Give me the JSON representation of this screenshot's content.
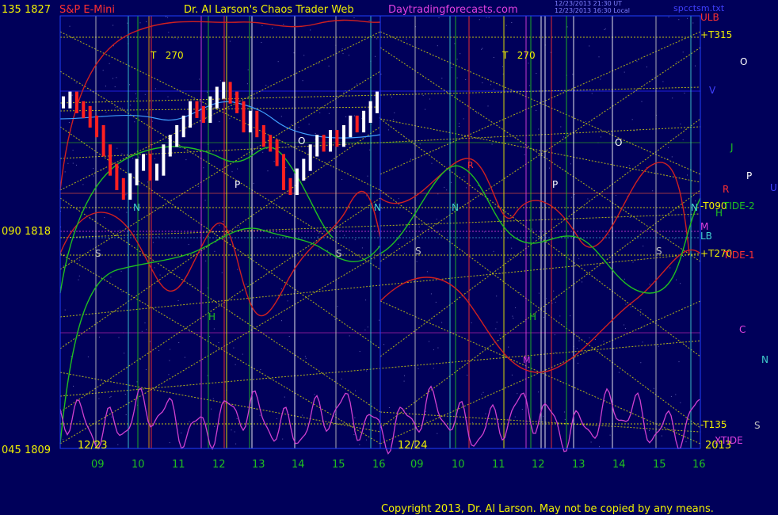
{
  "header": {
    "y_top_label": "135  1827",
    "instrument": "S&P E-Mini",
    "site_title": "Dr. Al Larson's Chaos Trader Web",
    "site_url": "Daytradingforecasts.com",
    "timestamp_1": "12/23/2013 21:30 UT",
    "timestamp_2": "12/23/2013 16:30 Local",
    "filename": "spcctsm.txt"
  },
  "y_labels": {
    "mid": "090  1818",
    "bottom": "045  1809"
  },
  "date_labels": [
    "12/23",
    "12/24"
  ],
  "x_ticks": [
    "09",
    "10",
    "11",
    "12",
    "13",
    "14",
    "15",
    "16",
    "09",
    "10",
    "11",
    "12",
    "13",
    "14",
    "15",
    "16"
  ],
  "year": "2013",
  "footer": "Copyright 2013, Dr. Al Larson. May not be copied by any means.",
  "right_labels": {
    "ulb": "ULB",
    "t315": "+T315",
    "t090": "-T090",
    "tide2": "TIDE-2",
    "m": "M",
    "lb": "LB",
    "t270": "+T270",
    "tide1": "TIDE-1",
    "t135": "-T135",
    "xtide": "XTIDE",
    "h": "H"
  },
  "planet_labels": {
    "o": "O",
    "v": "V",
    "j": "J",
    "p": "P",
    "r": "R",
    "u": "U",
    "c": "C",
    "n": "N",
    "s": "S"
  },
  "cycle_labels": {
    "t270a": "T   270",
    "t270b": "T   270"
  },
  "chart_markers": {
    "n": "N",
    "s": "S",
    "p": "P",
    "h": "H",
    "o": "O",
    "r": "R",
    "m": "M"
  },
  "colors": {
    "background": "#00005a",
    "price_up": "#ffffff",
    "price_down": "#ff2020",
    "tide1": "#d02020",
    "tide2": "#20c020",
    "xtide": "#d040d0",
    "title_yellow": "#f0f000",
    "url_magenta": "#e040e0",
    "ulb_red": "#ff4040",
    "grid_yellow": "#f0f000"
  },
  "chart_data": {
    "type": "line",
    "title": "S&P E-Mini",
    "y_price_ticks": [
      1827,
      1818,
      1809
    ],
    "y_angle_ticks": [
      135,
      90,
      45
    ],
    "ylim": [
      1809,
      1827
    ],
    "x_sessions": [
      "12/23",
      "12/24"
    ],
    "price_series_12_23": [
      1823.4,
      1823.6,
      1823.2,
      1823.0,
      1822.6,
      1822.2,
      1821.4,
      1820.6,
      1820.0,
      1819.6,
      1820.2,
      1820.8,
      1821.0,
      1820.4,
      1820.6,
      1821.4,
      1821.8,
      1822.2,
      1822.6,
      1823.2,
      1823.0,
      1822.8,
      1823.4,
      1823.8,
      1824.0,
      1823.6,
      1823.2,
      1822.4,
      1822.8,
      1822.2,
      1821.8,
      1821.6,
      1821.0,
      1820.0,
      1819.8,
      1820.4,
      1820.8,
      1821.4,
      1821.8,
      1821.6,
      1822.0,
      1821.8,
      1822.2,
      1822.6,
      1822.4,
      1822.8,
      1823.2,
      1823.6
    ],
    "series": [
      {
        "name": "TIDE-1"
      },
      {
        "name": "TIDE-2"
      },
      {
        "name": "XTIDE"
      }
    ]
  }
}
